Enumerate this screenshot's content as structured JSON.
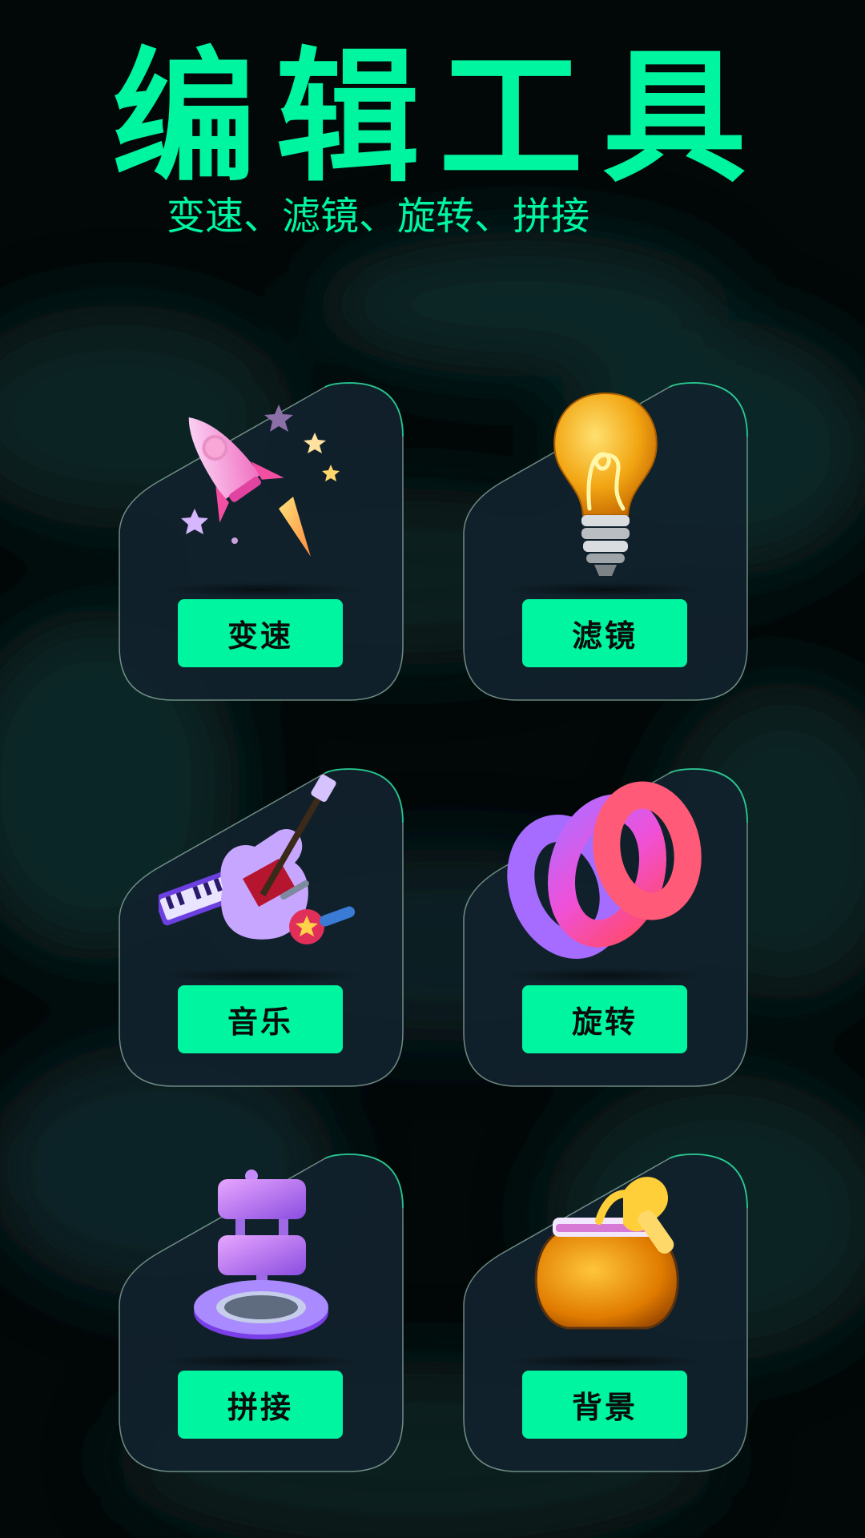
{
  "header": {
    "title": "编辑工具",
    "subtitle": "变速、滤镜、旋转、拼接"
  },
  "colors": {
    "accent": "#00F5A0",
    "background": "#020808",
    "card_fill": "#11222c",
    "button_text": "#0a0d0c"
  },
  "tools": [
    {
      "label": "变速",
      "icon": "rocket-icon"
    },
    {
      "label": "滤镜",
      "icon": "light-bulb-icon"
    },
    {
      "label": "音乐",
      "icon": "guitar-keyboard-icon"
    },
    {
      "label": "旋转",
      "icon": "twisted-loop-icon"
    },
    {
      "label": "拼接",
      "icon": "stacked-blocks-icon"
    },
    {
      "label": "背景",
      "icon": "honey-pot-icon"
    }
  ]
}
